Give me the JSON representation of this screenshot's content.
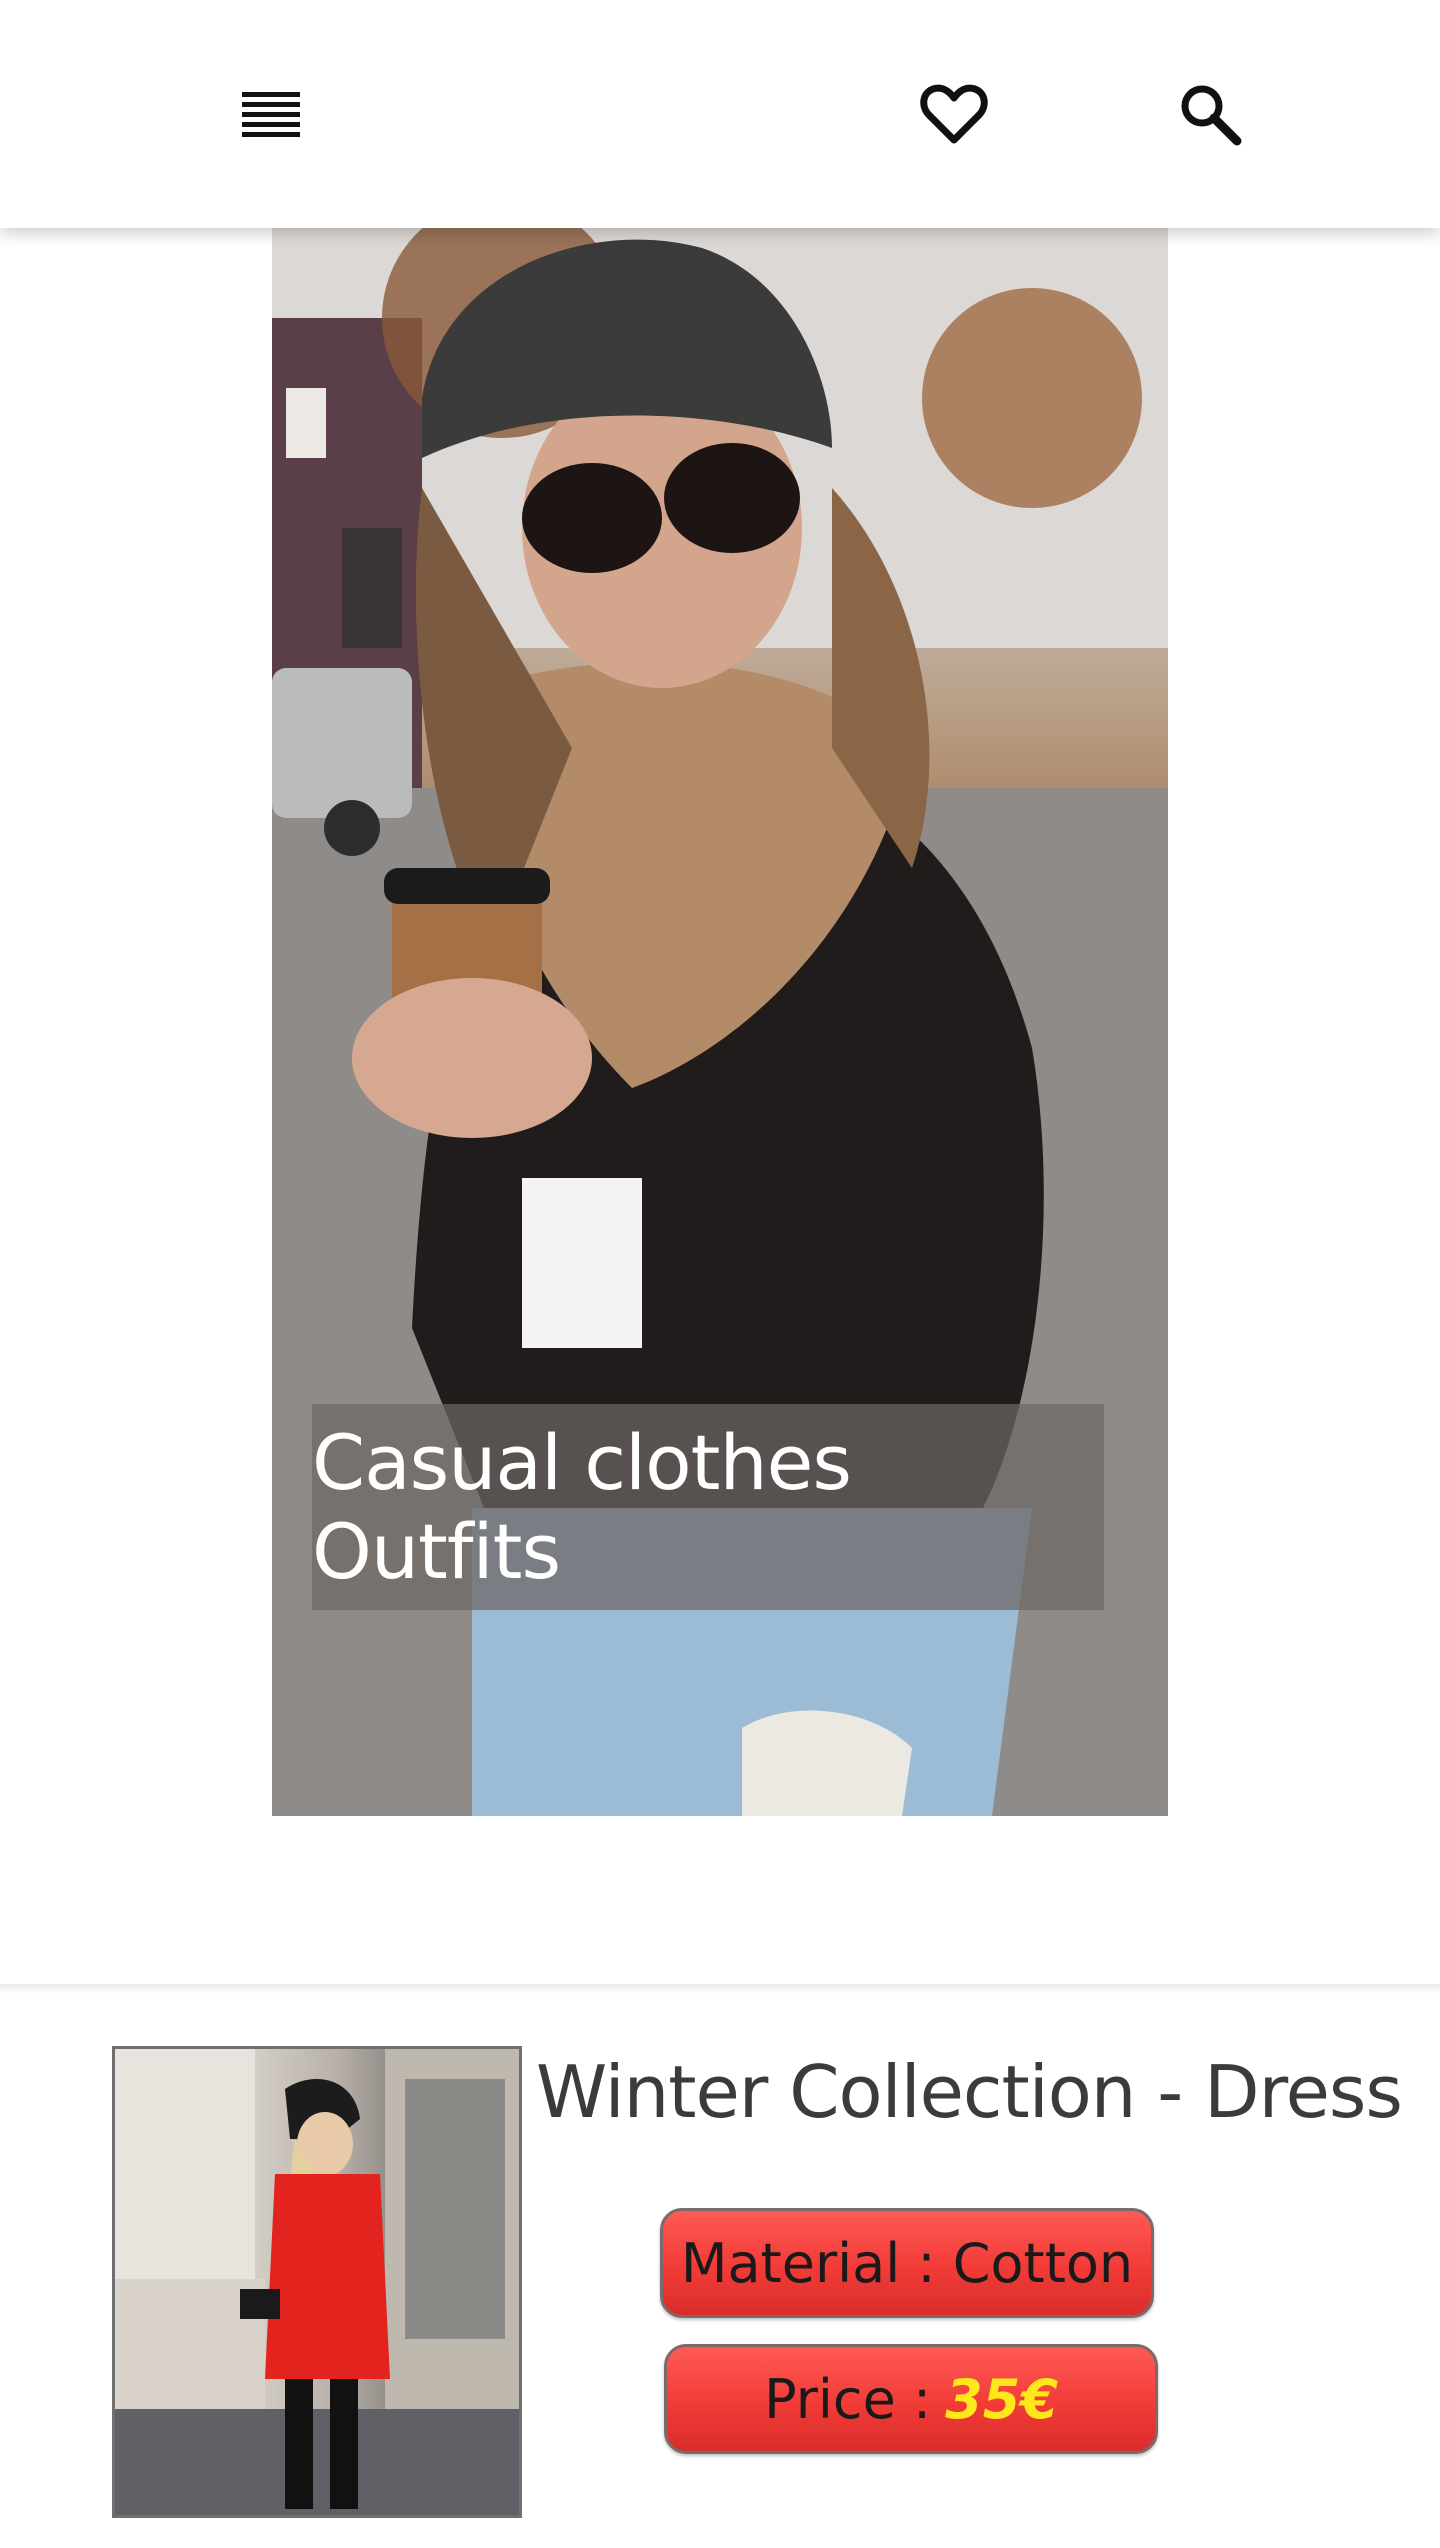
{
  "header": {
    "menu_icon": "menu-icon",
    "favorite_icon": "heart-icon",
    "search_icon": "search-icon"
  },
  "hero": {
    "caption": "Casual clothes Outfits"
  },
  "product": {
    "title": "Winter Collection - Dress",
    "material_label": "Material : Cotton",
    "price_label": "Price :",
    "price_value": "35€",
    "colors": {
      "pill": "#f23b37",
      "price_value": "#ffe81a"
    }
  }
}
